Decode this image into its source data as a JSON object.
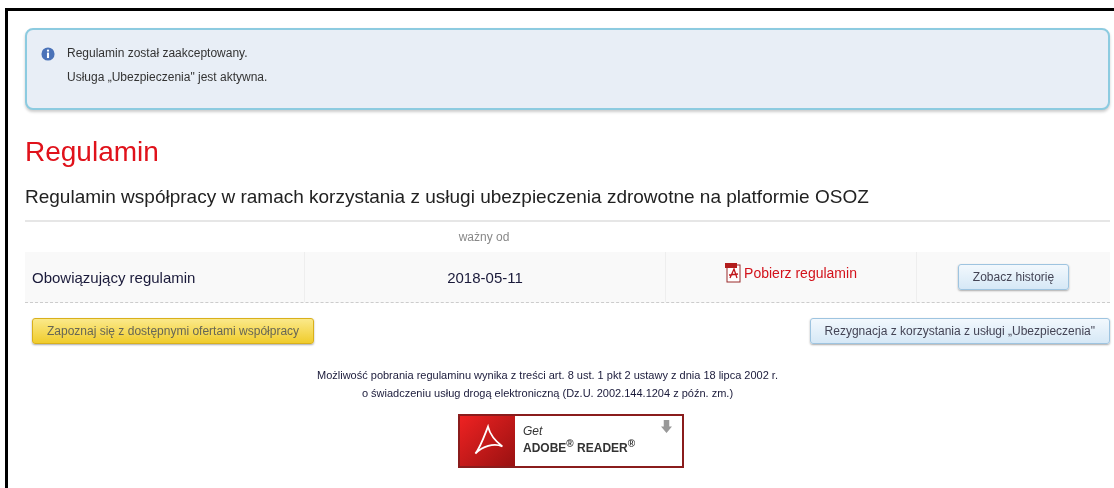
{
  "alert": {
    "lines": [
      "Regulamin został zaakceptowany.",
      "Usługa „Ubezpieczenia\" jest aktywna."
    ]
  },
  "title": "Regulamin",
  "subtitle": "Regulamin współpracy w ramach korzystania z usługi ubezpieczenia zdrowotne na platformie OSOZ",
  "table": {
    "column_2": "ważny od",
    "rows": [
      {
        "label": "Obowiązujący regulamin",
        "date": "2018-05-11",
        "link": "Pobierz regulamin",
        "button": "Zobacz historię"
      }
    ]
  },
  "buttons": [
    {
      "label": "Zapoznaj się z dostępnymi ofertami współpracy",
      "kind": "primary"
    },
    {
      "label": "Rezygnacja z korzystania z usługi „Ubezpieczenia\"",
      "kind": "secondary"
    }
  ],
  "note": [
    "Możliwość pobrania regulaminu wynika z treści art. 8 ust. 1 pkt 2 ustawy z dnia 18 lipca 2002 r.",
    "o świadczeniu usług drogą elektroniczną (Dz.U. 2002.144.1204 z późn. zm.)"
  ],
  "badge": {
    "small": "Get",
    "big": "ADOBE$^{®}$ READER$^{®}$"
  }
}
